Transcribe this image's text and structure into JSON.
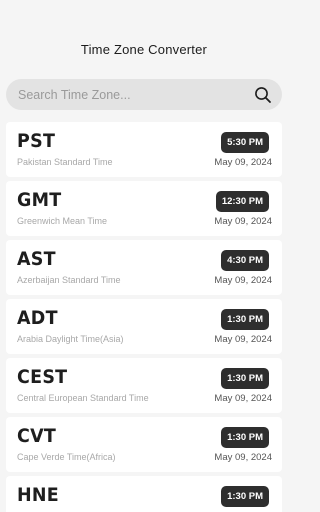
{
  "header": {
    "title": "Time Zone Converter"
  },
  "search": {
    "placeholder": "Search Time Zone...",
    "value": "",
    "icon": "search-icon"
  },
  "zones": [
    {
      "abbr": "PST",
      "name": "Pakistan Standard Time",
      "time": "5:30 PM",
      "date": "May 09, 2024"
    },
    {
      "abbr": "GMT",
      "name": "Greenwich Mean Time",
      "time": "12:30 PM",
      "date": "May 09, 2024"
    },
    {
      "abbr": "AST",
      "name": "Azerbaijan Standard Time",
      "time": "4:30 PM",
      "date": "May 09, 2024"
    },
    {
      "abbr": "ADT",
      "name": "Arabia Daylight Time(Asia)",
      "time": "1:30 PM",
      "date": "May 09, 2024"
    },
    {
      "abbr": "CEST",
      "name": "Central European Standard Time",
      "time": "1:30 PM",
      "date": "May 09, 2024"
    },
    {
      "abbr": "CVT",
      "name": "Cape Verde Time(Africa)",
      "time": "1:30 PM",
      "date": "May 09, 2024"
    },
    {
      "abbr": "HNE",
      "name": "",
      "time": "1:30 PM",
      "date": ""
    }
  ],
  "colors": {
    "background": "#f5f5f5",
    "card": "#ffffff",
    "badge": "#2e2e2e",
    "search_bg": "#e3e3e3"
  }
}
